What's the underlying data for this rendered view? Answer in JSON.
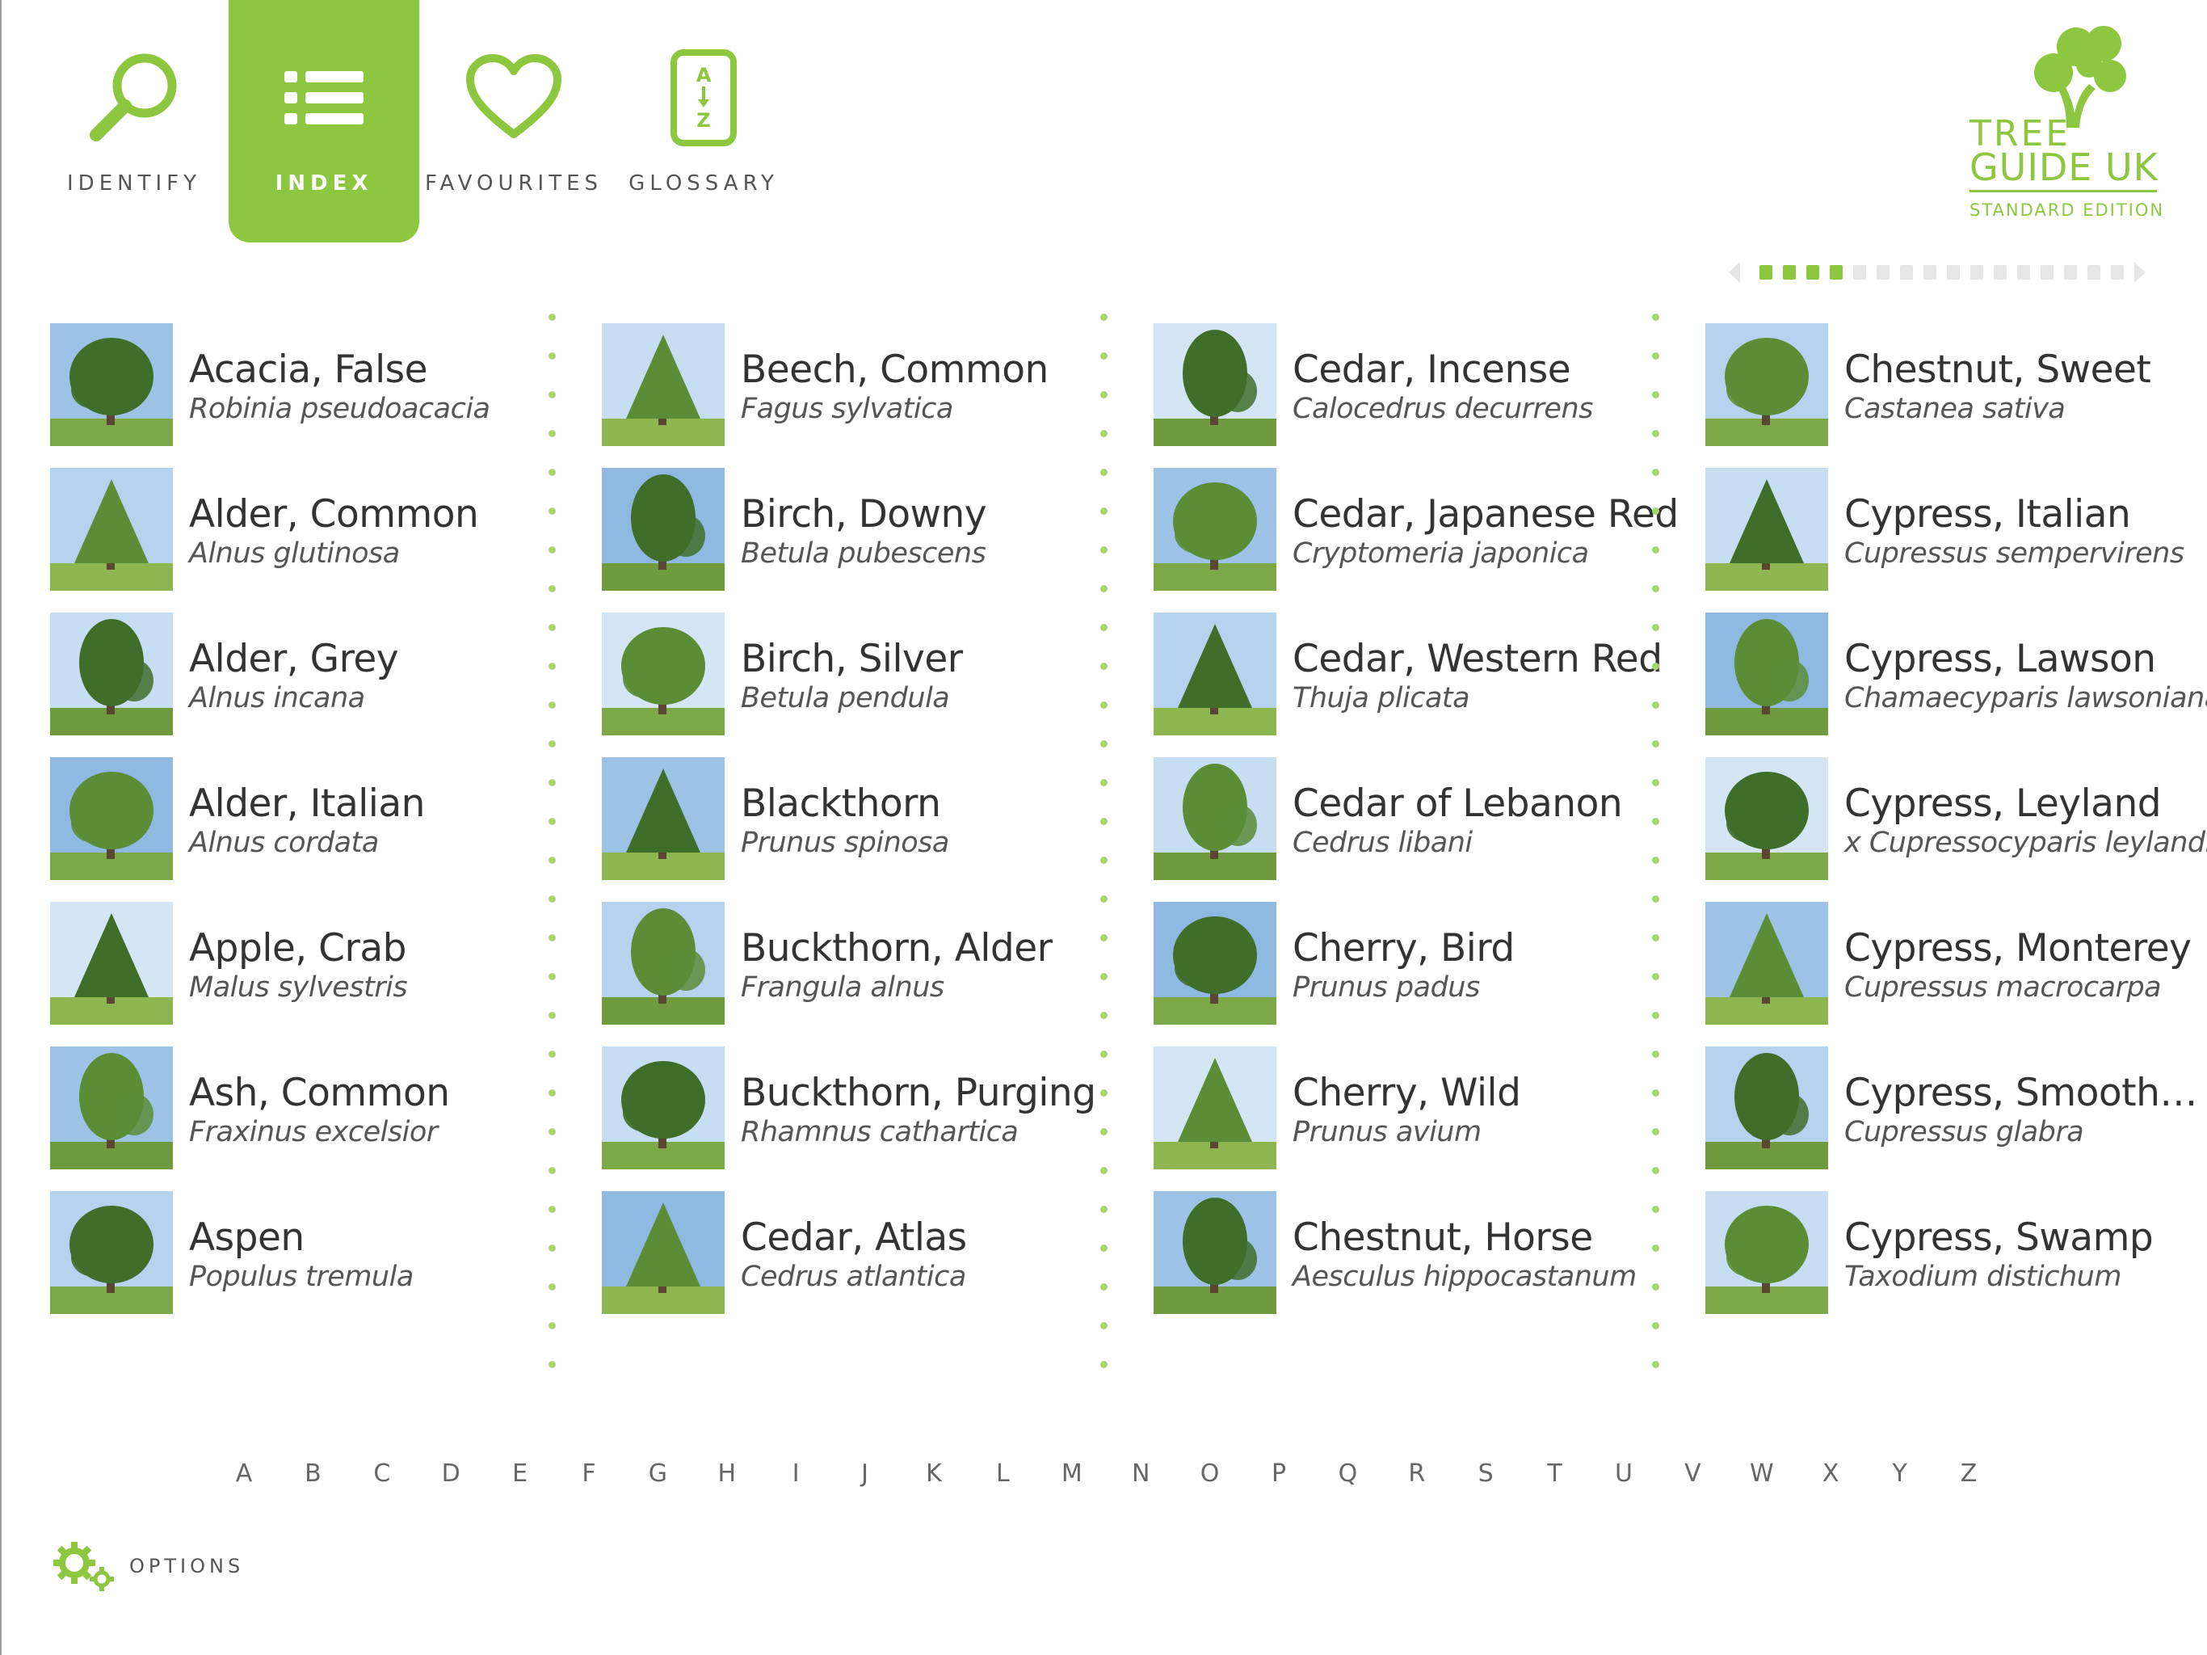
{
  "colors": {
    "accent": "#8dc63f",
    "accent_light": "#a6d66e",
    "text_dark": "#333333",
    "text_muted": "#555555",
    "inactive_dot": "#e6e6e6"
  },
  "nav": {
    "items": [
      {
        "label": "IDENTIFY",
        "icon": "magnifier-icon",
        "active": false
      },
      {
        "label": "INDEX",
        "icon": "list-icon",
        "active": true
      },
      {
        "label": "FAVOURITES",
        "icon": "heart-icon",
        "active": false
      },
      {
        "label": "GLOSSARY",
        "icon": "az-icon",
        "active": false
      }
    ]
  },
  "logo": {
    "line1": "TREE",
    "line2": "GUIDE UK",
    "line3": "STANDARD EDITION"
  },
  "pager": {
    "total_pages": 16,
    "highlighted_pages": [
      1,
      2,
      3,
      4
    ]
  },
  "columns": [
    [
      {
        "common": "Acacia, False",
        "latin": "Robinia pseudoacacia"
      },
      {
        "common": "Alder, Common",
        "latin": "Alnus glutinosa"
      },
      {
        "common": "Alder, Grey",
        "latin": "Alnus incana"
      },
      {
        "common": "Alder, Italian",
        "latin": "Alnus cordata"
      },
      {
        "common": "Apple, Crab",
        "latin": "Malus sylvestris"
      },
      {
        "common": "Ash, Common",
        "latin": "Fraxinus excelsior"
      },
      {
        "common": "Aspen",
        "latin": "Populus tremula"
      }
    ],
    [
      {
        "common": "Beech, Common",
        "latin": "Fagus sylvatica"
      },
      {
        "common": "Birch, Downy",
        "latin": "Betula  pubescens"
      },
      {
        "common": "Birch, Silver",
        "latin": "Betula pendula"
      },
      {
        "common": "Blackthorn",
        "latin": "Prunus spinosa"
      },
      {
        "common": "Buckthorn, Alder",
        "latin": "Frangula alnus"
      },
      {
        "common": "Buckthorn, Purging",
        "latin": "Rhamnus cathartica"
      },
      {
        "common": "Cedar, Atlas",
        "latin": "Cedrus atlantica"
      }
    ],
    [
      {
        "common": "Cedar, Incense",
        "latin": "Calocedrus decurrens"
      },
      {
        "common": "Cedar, Japanese Red",
        "latin": "Cryptomeria japonica"
      },
      {
        "common": "Cedar, Western Red",
        "latin": "Thuja plicata"
      },
      {
        "common": "Cedar of Lebanon",
        "latin": "Cedrus libani"
      },
      {
        "common": "Cherry, Bird",
        "latin": "Prunus padus"
      },
      {
        "common": "Cherry, Wild",
        "latin": "Prunus avium"
      },
      {
        "common": "Chestnut, Horse",
        "latin": "Aesculus hippocastanum"
      }
    ],
    [
      {
        "common": "Chestnut, Sweet",
        "latin": "Castanea sativa"
      },
      {
        "common": "Cypress, Italian",
        "latin": "Cupressus sempervirens"
      },
      {
        "common": "Cypress, Lawson",
        "latin": "Chamaecyparis lawsoniana"
      },
      {
        "common": "Cypress, Leyland",
        "latin": "x Cupressocyparis leylandii"
      },
      {
        "common": "Cypress, Monterey",
        "latin": "Cupressus macrocarpa"
      },
      {
        "common": "Cypress, Smooth…",
        "latin": "Cupressus glabra"
      },
      {
        "common": "Cypress, Swamp",
        "latin": "Taxodium distichum"
      }
    ]
  ],
  "alphabet": [
    "A",
    "B",
    "C",
    "D",
    "E",
    "F",
    "G",
    "H",
    "I",
    "J",
    "K",
    "L",
    "M",
    "N",
    "O",
    "P",
    "Q",
    "R",
    "S",
    "T",
    "U",
    "V",
    "W",
    "X",
    "Y",
    "Z"
  ],
  "options": {
    "label": "OPTIONS"
  }
}
